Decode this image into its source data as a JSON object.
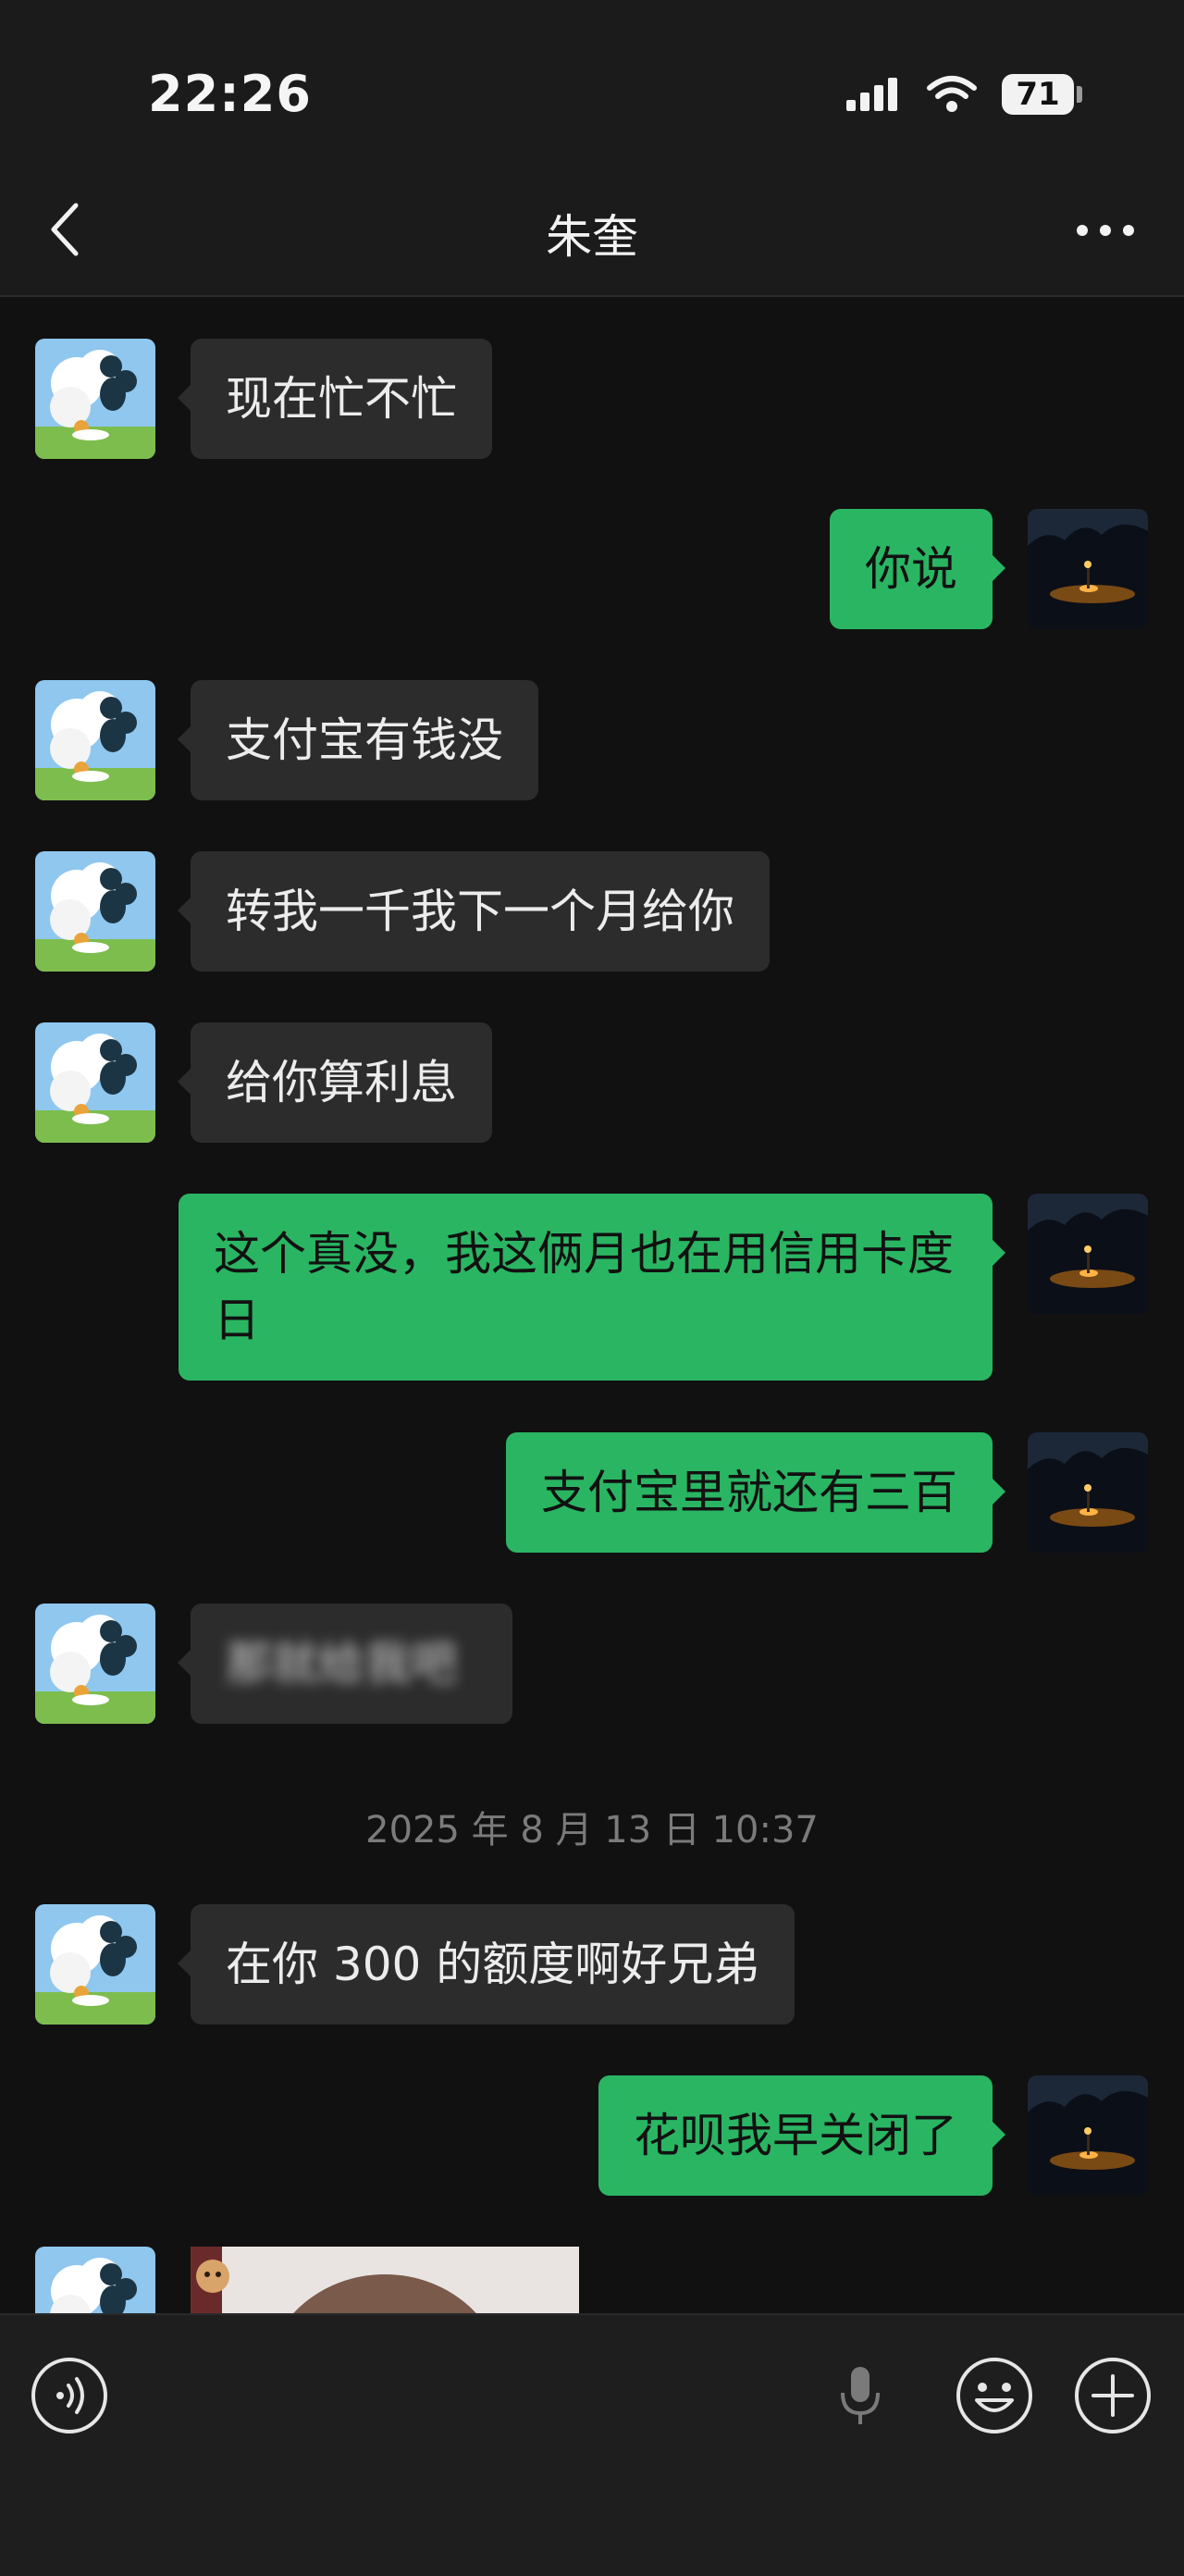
{
  "status_bar": {
    "time": "22:26",
    "battery": "71"
  },
  "nav": {
    "title": "朱奎"
  },
  "messages": [
    {
      "side": "left",
      "text": "现在忙不忙"
    },
    {
      "side": "right",
      "text": "你说"
    },
    {
      "side": "left",
      "text": "支付宝有钱没"
    },
    {
      "side": "left",
      "text": "转我一千我下一个月给你"
    },
    {
      "side": "left",
      "text": "给你算利息"
    },
    {
      "side": "right",
      "text": "这个真没，我这俩月也在用信用卡度日"
    },
    {
      "side": "right",
      "text": "支付宝里就还有三百"
    },
    {
      "side": "left",
      "text": "那就给我吧",
      "blurred": true
    },
    {
      "side": "left",
      "text": "在你 300 的额度啊好兄弟"
    },
    {
      "side": "right",
      "text": "花呗我早关闭了"
    }
  ],
  "timestamp": "2025 年 8 月 13 日  10:37",
  "colors": {
    "sent_bubble": "#2ab563",
    "received_bubble": "#2c2c2c",
    "background": "#111111"
  },
  "icons": [
    "back-icon",
    "more-icon",
    "voice-icon",
    "mic-icon",
    "emoji-icon",
    "plus-icon"
  ]
}
